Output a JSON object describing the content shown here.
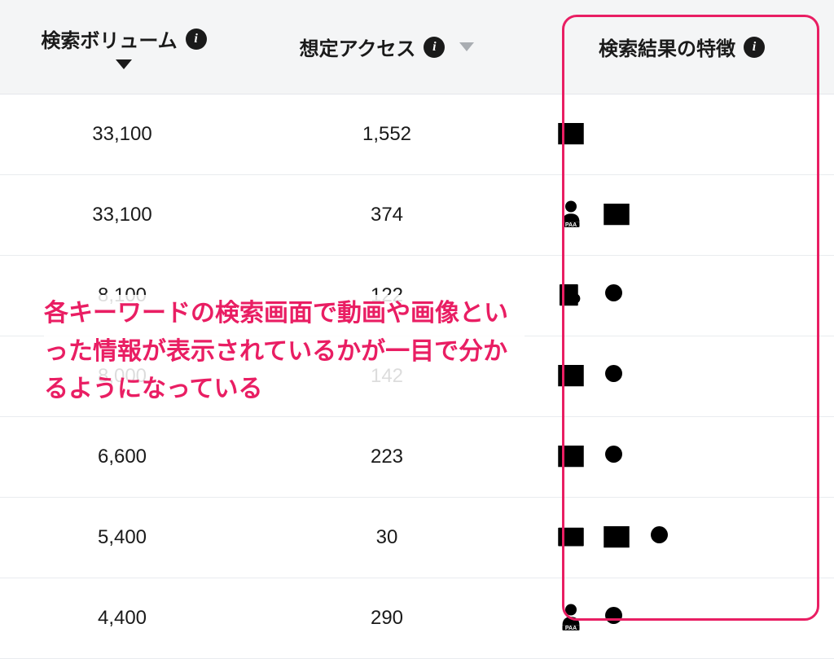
{
  "headers": {
    "volume": "検索ボリューム",
    "access": "想定アクセス",
    "features": "検索結果の特徴"
  },
  "info_glyph": "i",
  "rows": [
    {
      "volume": "33,100",
      "access": "1,552",
      "features": [
        "image"
      ]
    },
    {
      "volume": "33,100",
      "access": "374",
      "features": [
        "paa",
        "image"
      ]
    },
    {
      "volume": "8,100",
      "access": "122",
      "features": [
        "doc-search",
        "magnify"
      ]
    },
    {
      "volume": "8,000",
      "access": "142",
      "features": [
        "image",
        "magnify"
      ]
    },
    {
      "volume": "6,600",
      "access": "223",
      "features": [
        "image",
        "magnify"
      ]
    },
    {
      "volume": "5,400",
      "access": "30",
      "features": [
        "video",
        "image",
        "magnify"
      ]
    },
    {
      "volume": "4,400",
      "access": "290",
      "features": [
        "paa",
        "magnify"
      ]
    }
  ],
  "annotation_text": "各キーワードの検索画面で動画や画像といった情報が表示されているかが一目で分かるようになっている"
}
